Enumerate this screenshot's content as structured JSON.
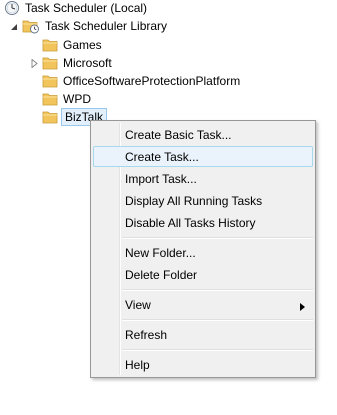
{
  "tree": {
    "root": {
      "label": "Task Scheduler (Local)",
      "icon": "clock-icon"
    },
    "library": {
      "label": "Task Scheduler Library",
      "icon": "folder-clock-icon",
      "expanded": true
    },
    "folders": [
      {
        "label": "Games",
        "has_children": false,
        "selected": false
      },
      {
        "label": "Microsoft",
        "has_children": true,
        "selected": false
      },
      {
        "label": "OfficeSoftwareProtectionPlatform",
        "has_children": false,
        "selected": false
      },
      {
        "label": "WPD",
        "has_children": false,
        "selected": false
      },
      {
        "label": "BizTalk",
        "has_children": false,
        "selected": true
      }
    ]
  },
  "context_menu": {
    "items": [
      {
        "label": "Create Basic Task...",
        "highlighted": false
      },
      {
        "label": "Create Task...",
        "highlighted": true
      },
      {
        "label": "Import Task...",
        "highlighted": false
      },
      {
        "label": "Display All Running Tasks",
        "highlighted": false
      },
      {
        "label": "Disable All Tasks History",
        "highlighted": false
      },
      {
        "label": "New Folder...",
        "highlighted": false
      },
      {
        "label": "Delete Folder",
        "highlighted": false
      },
      {
        "label": "View",
        "highlighted": false,
        "submenu": true
      },
      {
        "label": "Refresh",
        "highlighted": false
      },
      {
        "label": "Help",
        "highlighted": false
      }
    ]
  },
  "colors": {
    "folder": "#f2c55c",
    "folder_dark": "#d9a23a",
    "selection_bg": "#e3f0fb",
    "selection_border": "#99c8ee",
    "menu_bg": "#f0f0f0",
    "menu_highlight_bg": "#eaf2fb",
    "menu_highlight_border": "#a8d8eb"
  }
}
